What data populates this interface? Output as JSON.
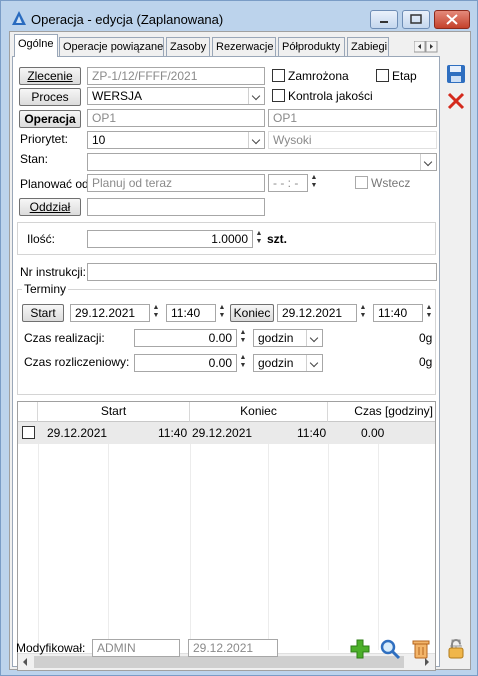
{
  "window": {
    "title": "Operacja - edycja (Zaplanowana)"
  },
  "tabs": [
    "Ogólne",
    "Operacje powiązane",
    "Zasoby",
    "Rezerwacje",
    "Półprodukty",
    "Zabiegi"
  ],
  "form": {
    "zlecenie_btn": "Zlecenie",
    "zlecenie_value": "ZP-1/12/FFFF/2021",
    "zamrozona_label": "Zamrożona",
    "etap_label": "Etap",
    "proces_btn": "Proces",
    "proces_value": "WERSJA",
    "kontrola_label": "Kontrola jakości",
    "operacja_btn": "Operacja",
    "operacja_code": "OP1",
    "operacja_name": "OP1",
    "priorytet_label": "Priorytet:",
    "priorytet_value": "10",
    "priorytet_desc": "Wysoki",
    "stan_label": "Stan:",
    "stan_value": "",
    "planowac_label": "Planować od:",
    "planowac_value": "Planuj od teraz",
    "planowac_time": "- - : -",
    "wstecz_label": "Wstecz",
    "oddzial_btn": "Oddział",
    "oddzial_value": "",
    "ilosc_label": "Ilość:",
    "ilosc_value": "1.0000",
    "ilosc_unit": "szt.",
    "nr_instrukcji_label": "Nr instrukcji:",
    "nr_instrukcji_value": ""
  },
  "terminy": {
    "legend": "Terminy",
    "start_btn": "Start",
    "start_date": "29.12.2021",
    "start_time": "11:40",
    "koniec_btn": "Koniec",
    "koniec_date": "29.12.2021",
    "koniec_time": "11:40",
    "czas_realizacji_label": "Czas realizacji:",
    "czas_realizacji_value": "0.00",
    "czas_realizacji_unit": "godzin",
    "czas_realizacji_g": "0g",
    "czas_rozliczeniowy_label": "Czas rozliczeniowy:",
    "czas_rozliczeniowy_value": "0.00",
    "czas_rozliczeniowy_unit": "godzin",
    "czas_rozliczeniowy_g": "0g"
  },
  "grid": {
    "headers": [
      "Start",
      "Koniec",
      "Czas [godziny]"
    ],
    "row": {
      "start_date": "29.12.2021",
      "start_time": "11:40",
      "end_date": "29.12.2021",
      "end_time": "11:40",
      "czas": "0.00"
    }
  },
  "footer": {
    "modyfikowal_label": "Modyfikował:",
    "user": "ADMIN",
    "date": "29.12.2021"
  },
  "colors": {
    "accent": "#3a7bd5",
    "save": "#2f6fc0",
    "cancel": "#d42a1c",
    "add": "#4caf2a"
  }
}
